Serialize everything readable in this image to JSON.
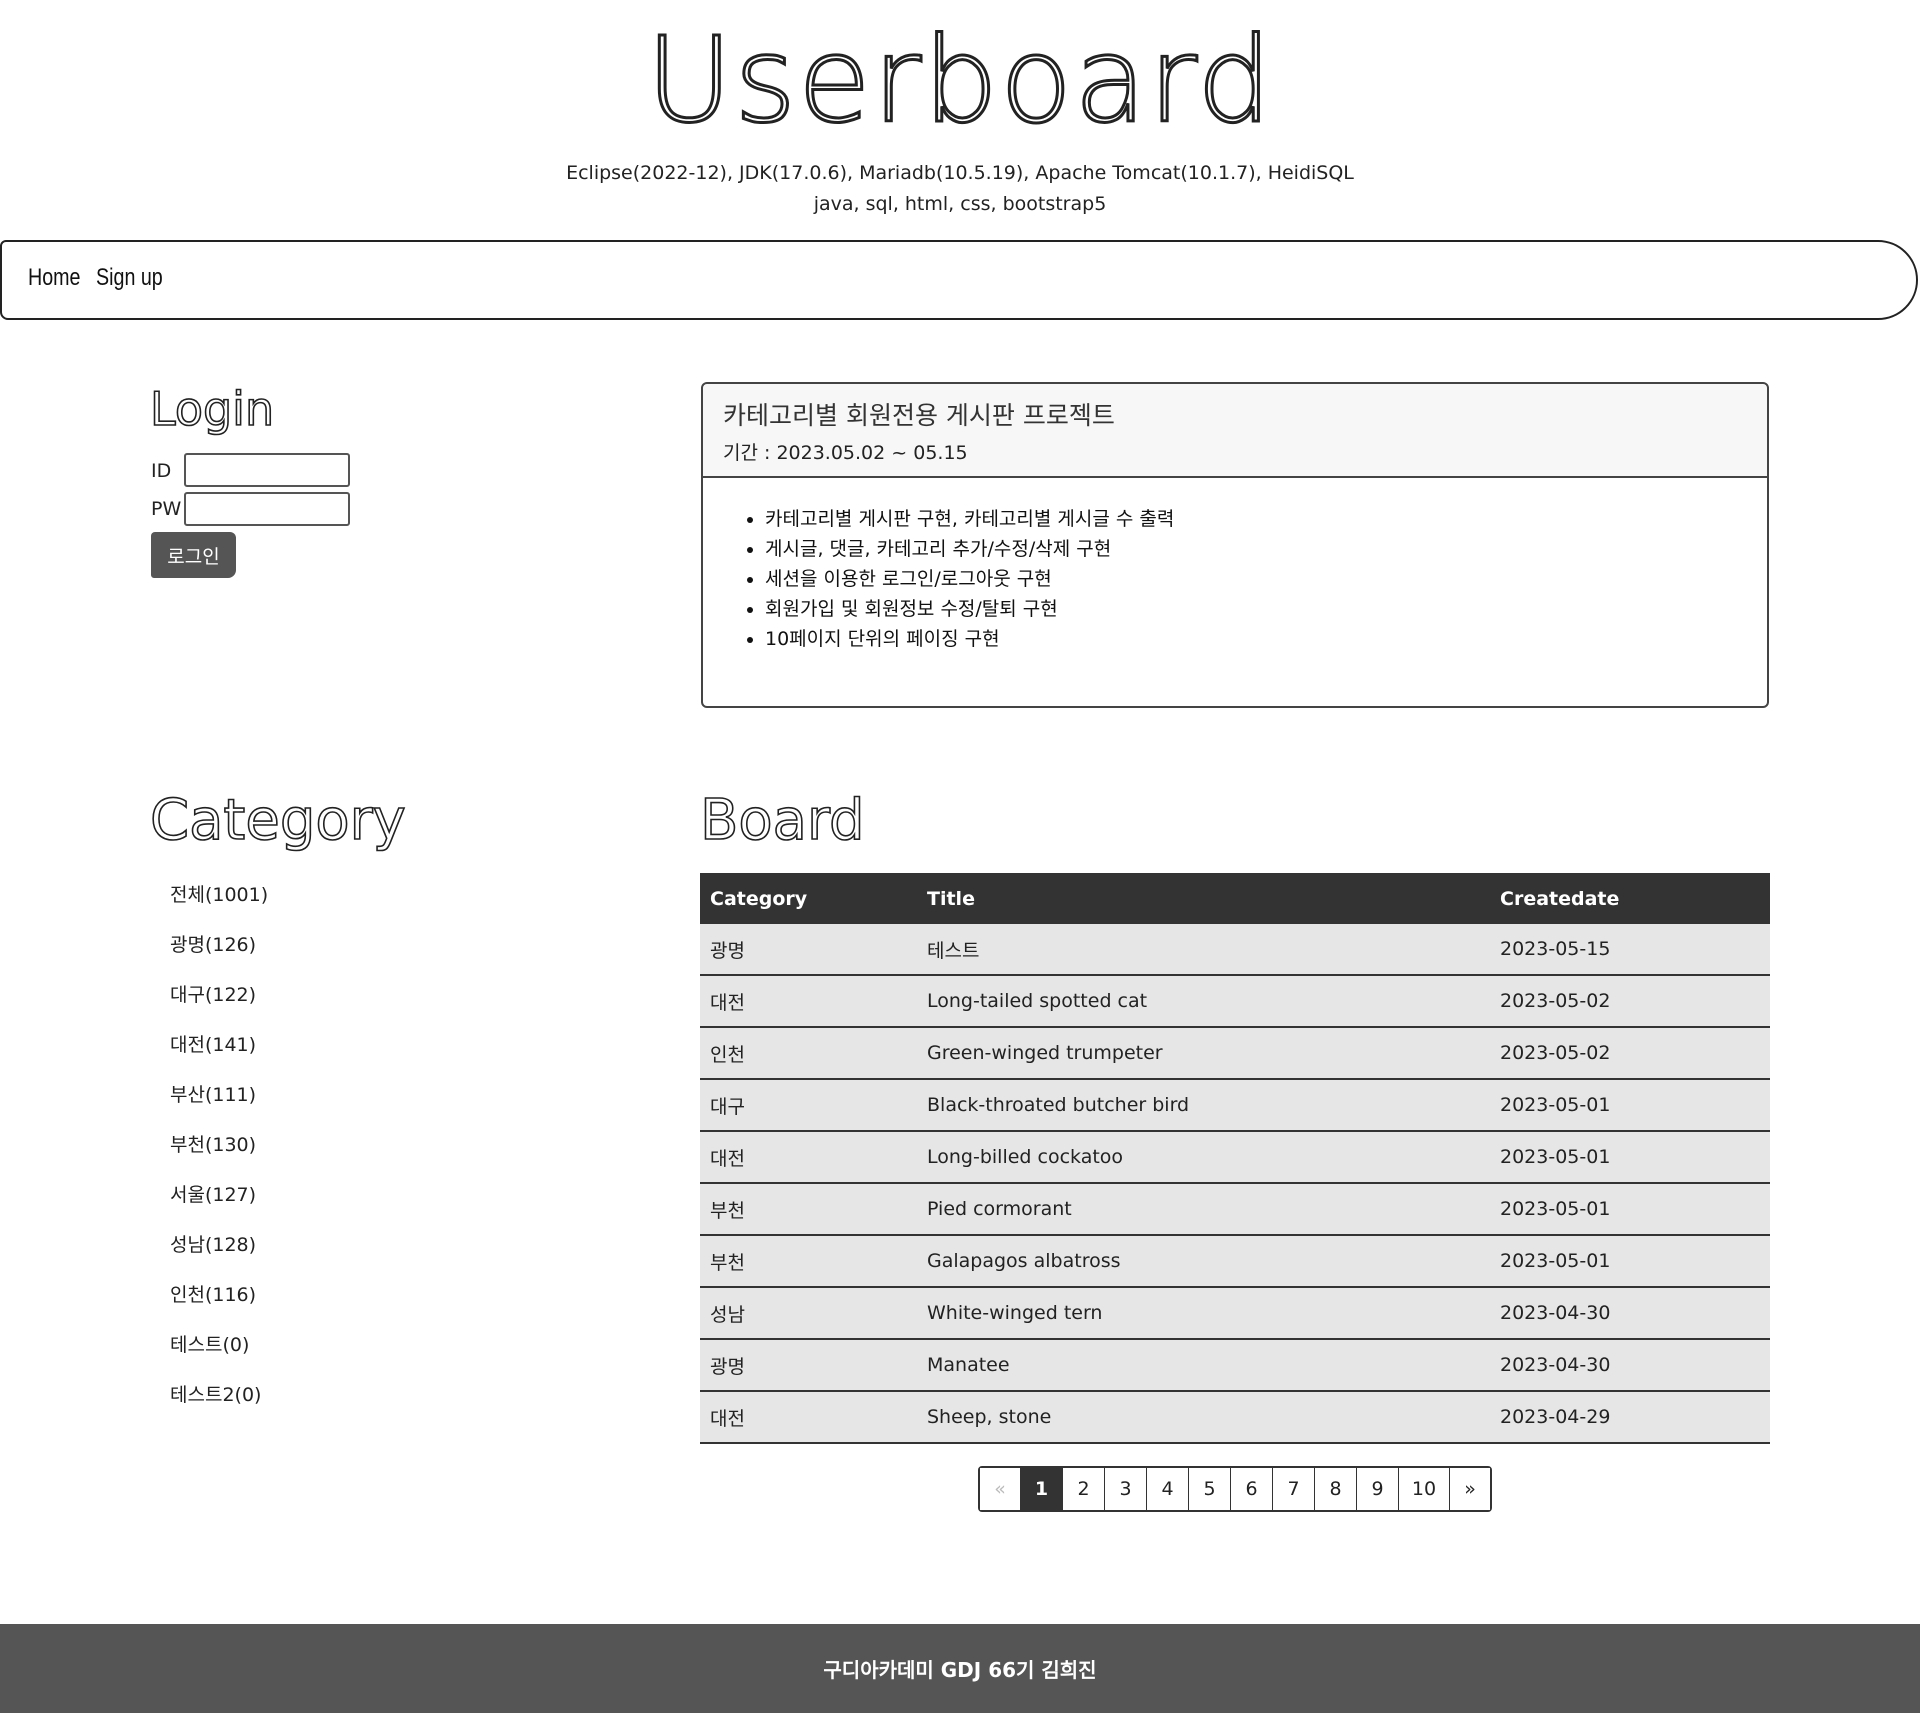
{
  "header": {
    "site_title": "Userboard",
    "tech_line_1": "Eclipse(2022-12), JDK(17.0.6), Mariadb(10.5.19), Apache Tomcat(10.1.7), HeidiSQL",
    "tech_line_2": "java, sql, html, css, bootstrap5"
  },
  "nav": {
    "home": "Home",
    "signup": "Sign up"
  },
  "login": {
    "heading": "Login",
    "id_label": "ID",
    "pw_label": "PW",
    "id_value": "",
    "pw_value": "",
    "button_label": "로그인"
  },
  "project": {
    "title": "카테고리별 회원전용 게시판 프로젝트",
    "period": "기간 : 2023.05.02 ~ 05.15",
    "features": [
      "카테고리별 게시판 구현, 카테고리별 게시글 수 출력",
      "게시글, 댓글, 카테고리 추가/수정/삭제 구현",
      "세션을 이용한 로그인/로그아웃 구현",
      "회원가입 및 회원정보 수정/탈퇴 구현",
      "10페이지 단위의 페이징 구현"
    ]
  },
  "category": {
    "heading": "Category",
    "items": [
      "전체(1001)",
      "광명(126)",
      "대구(122)",
      "대전(141)",
      "부산(111)",
      "부천(130)",
      "서울(127)",
      "성남(128)",
      "인천(116)",
      "테스트(0)",
      "테스트2(0)"
    ]
  },
  "board": {
    "heading": "Board",
    "columns": [
      "Category",
      "Title",
      "Createdate"
    ],
    "rows": [
      {
        "category": "광명",
        "title": "테스트",
        "createdate": "2023-05-15"
      },
      {
        "category": "대전",
        "title": "Long-tailed spotted cat",
        "createdate": "2023-05-02"
      },
      {
        "category": "인천",
        "title": "Green-winged trumpeter",
        "createdate": "2023-05-02"
      },
      {
        "category": "대구",
        "title": "Black-throated butcher bird",
        "createdate": "2023-05-01"
      },
      {
        "category": "대전",
        "title": "Long-billed cockatoo",
        "createdate": "2023-05-01"
      },
      {
        "category": "부천",
        "title": "Pied cormorant",
        "createdate": "2023-05-01"
      },
      {
        "category": "부천",
        "title": "Galapagos albatross",
        "createdate": "2023-05-01"
      },
      {
        "category": "성남",
        "title": "White-winged tern",
        "createdate": "2023-04-30"
      },
      {
        "category": "광명",
        "title": "Manatee",
        "createdate": "2023-04-30"
      },
      {
        "category": "대전",
        "title": "Sheep, stone",
        "createdate": "2023-04-29"
      }
    ]
  },
  "pagination": {
    "prev": "«",
    "pages": [
      "1",
      "2",
      "3",
      "4",
      "5",
      "6",
      "7",
      "8",
      "9",
      "10"
    ],
    "next": "»",
    "current": "1"
  },
  "footer": {
    "text": "구디아카데미 GDJ 66기 김희진"
  },
  "colors": {
    "dark": "#333333",
    "footer_bg": "#555555",
    "row_bg": "#e6e6e6"
  }
}
